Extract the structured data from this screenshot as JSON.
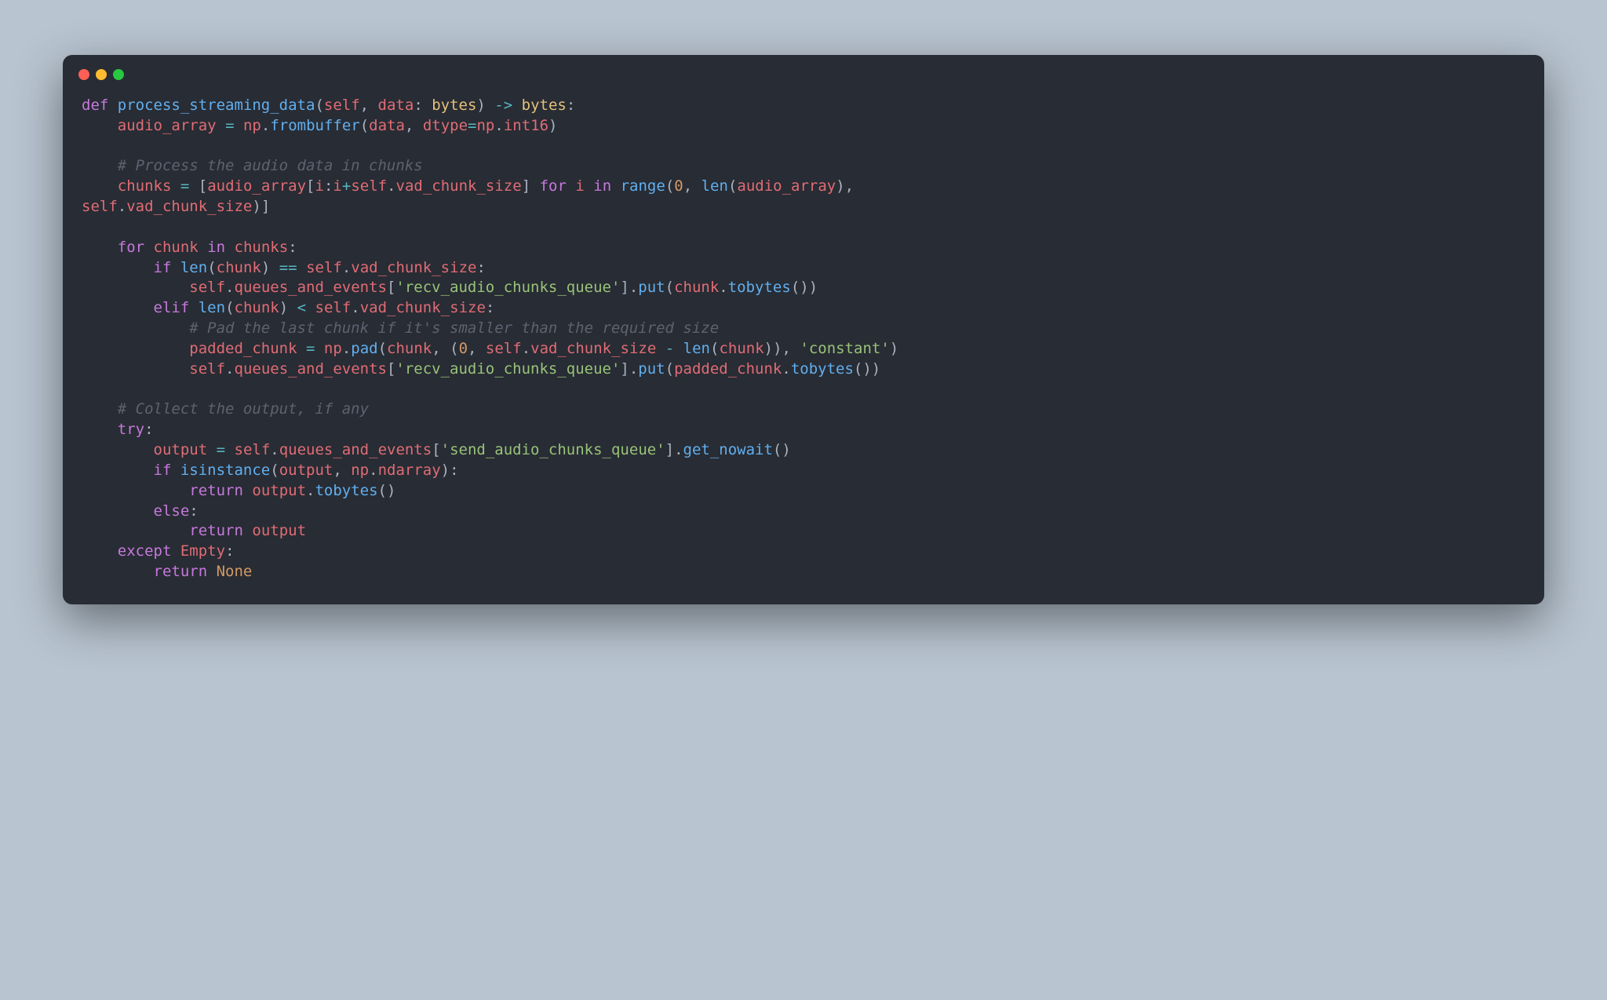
{
  "theme": {
    "page_bg": "#b8c4d0",
    "editor_bg": "#282c34",
    "foreground": "#abb2bf",
    "keyword": "#c678dd",
    "function": "#61afef",
    "type": "#e5c07b",
    "variable": "#e06c75",
    "operator": "#56b6c2",
    "string": "#98c379",
    "number": "#d19a66",
    "comment": "#5c6370",
    "constant": "#d19a66",
    "btn_red": "#ff5f57",
    "btn_yellow": "#febc2e",
    "btn_green": "#28c840"
  },
  "titlebar": {
    "btn1": "close",
    "btn2": "minimize",
    "btn3": "zoom"
  },
  "code": {
    "language": "python",
    "lines": [
      [
        [
          "kw",
          "def "
        ],
        [
          "fn",
          "process_streaming_data"
        ],
        [
          "pun",
          "("
        ],
        [
          "var",
          "self"
        ],
        [
          "pun",
          ", "
        ],
        [
          "var",
          "data"
        ],
        [
          "pun",
          ": "
        ],
        [
          "ty",
          "bytes"
        ],
        [
          "pun",
          ") "
        ],
        [
          "op",
          "->"
        ],
        [
          "pun",
          " "
        ],
        [
          "ty",
          "bytes"
        ],
        [
          "pun",
          ":"
        ]
      ],
      [
        [
          "pun",
          "    "
        ],
        [
          "var",
          "audio_array"
        ],
        [
          "pun",
          " "
        ],
        [
          "op",
          "="
        ],
        [
          "pun",
          " "
        ],
        [
          "var",
          "np"
        ],
        [
          "pun",
          "."
        ],
        [
          "fn",
          "frombuffer"
        ],
        [
          "pun",
          "("
        ],
        [
          "var",
          "data"
        ],
        [
          "pun",
          ", "
        ],
        [
          "var",
          "dtype"
        ],
        [
          "op",
          "="
        ],
        [
          "var",
          "np"
        ],
        [
          "pun",
          "."
        ],
        [
          "var",
          "int16"
        ],
        [
          "pun",
          ")"
        ]
      ],
      [
        [
          "pun",
          ""
        ]
      ],
      [
        [
          "pun",
          "    "
        ],
        [
          "com",
          "# Process the audio data in chunks"
        ]
      ],
      [
        [
          "pun",
          "    "
        ],
        [
          "var",
          "chunks"
        ],
        [
          "pun",
          " "
        ],
        [
          "op",
          "="
        ],
        [
          "pun",
          " ["
        ],
        [
          "var",
          "audio_array"
        ],
        [
          "pun",
          "["
        ],
        [
          "var",
          "i"
        ],
        [
          "pun",
          ":"
        ],
        [
          "var",
          "i"
        ],
        [
          "op",
          "+"
        ],
        [
          "var",
          "self"
        ],
        [
          "pun",
          "."
        ],
        [
          "var",
          "vad_chunk_size"
        ],
        [
          "pun",
          "] "
        ],
        [
          "kw",
          "for"
        ],
        [
          "pun",
          " "
        ],
        [
          "var",
          "i"
        ],
        [
          "pun",
          " "
        ],
        [
          "kw",
          "in"
        ],
        [
          "pun",
          " "
        ],
        [
          "fn",
          "range"
        ],
        [
          "pun",
          "("
        ],
        [
          "num",
          "0"
        ],
        [
          "pun",
          ", "
        ],
        [
          "fn",
          "len"
        ],
        [
          "pun",
          "("
        ],
        [
          "var",
          "audio_array"
        ],
        [
          "pun",
          "), "
        ]
      ],
      [
        [
          "var",
          "self"
        ],
        [
          "pun",
          "."
        ],
        [
          "var",
          "vad_chunk_size"
        ],
        [
          "pun",
          ")]"
        ]
      ],
      [
        [
          "pun",
          ""
        ]
      ],
      [
        [
          "pun",
          "    "
        ],
        [
          "kw",
          "for"
        ],
        [
          "pun",
          " "
        ],
        [
          "var",
          "chunk"
        ],
        [
          "pun",
          " "
        ],
        [
          "kw",
          "in"
        ],
        [
          "pun",
          " "
        ],
        [
          "var",
          "chunks"
        ],
        [
          "pun",
          ":"
        ]
      ],
      [
        [
          "pun",
          "        "
        ],
        [
          "kw",
          "if"
        ],
        [
          "pun",
          " "
        ],
        [
          "fn",
          "len"
        ],
        [
          "pun",
          "("
        ],
        [
          "var",
          "chunk"
        ],
        [
          "pun",
          ") "
        ],
        [
          "op",
          "=="
        ],
        [
          "pun",
          " "
        ],
        [
          "var",
          "self"
        ],
        [
          "pun",
          "."
        ],
        [
          "var",
          "vad_chunk_size"
        ],
        [
          "pun",
          ":"
        ]
      ],
      [
        [
          "pun",
          "            "
        ],
        [
          "var",
          "self"
        ],
        [
          "pun",
          "."
        ],
        [
          "var",
          "queues_and_events"
        ],
        [
          "pun",
          "["
        ],
        [
          "str",
          "'recv_audio_chunks_queue'"
        ],
        [
          "pun",
          "]."
        ],
        [
          "fn",
          "put"
        ],
        [
          "pun",
          "("
        ],
        [
          "var",
          "chunk"
        ],
        [
          "pun",
          "."
        ],
        [
          "fn",
          "tobytes"
        ],
        [
          "pun",
          "())"
        ]
      ],
      [
        [
          "pun",
          "        "
        ],
        [
          "kw",
          "elif"
        ],
        [
          "pun",
          " "
        ],
        [
          "fn",
          "len"
        ],
        [
          "pun",
          "("
        ],
        [
          "var",
          "chunk"
        ],
        [
          "pun",
          ") "
        ],
        [
          "op",
          "<"
        ],
        [
          "pun",
          " "
        ],
        [
          "var",
          "self"
        ],
        [
          "pun",
          "."
        ],
        [
          "var",
          "vad_chunk_size"
        ],
        [
          "pun",
          ":"
        ]
      ],
      [
        [
          "pun",
          "            "
        ],
        [
          "com",
          "# Pad the last chunk if it's smaller than the required size"
        ]
      ],
      [
        [
          "pun",
          "            "
        ],
        [
          "var",
          "padded_chunk"
        ],
        [
          "pun",
          " "
        ],
        [
          "op",
          "="
        ],
        [
          "pun",
          " "
        ],
        [
          "var",
          "np"
        ],
        [
          "pun",
          "."
        ],
        [
          "fn",
          "pad"
        ],
        [
          "pun",
          "("
        ],
        [
          "var",
          "chunk"
        ],
        [
          "pun",
          ", ("
        ],
        [
          "num",
          "0"
        ],
        [
          "pun",
          ", "
        ],
        [
          "var",
          "self"
        ],
        [
          "pun",
          "."
        ],
        [
          "var",
          "vad_chunk_size"
        ],
        [
          "pun",
          " "
        ],
        [
          "op",
          "-"
        ],
        [
          "pun",
          " "
        ],
        [
          "fn",
          "len"
        ],
        [
          "pun",
          "("
        ],
        [
          "var",
          "chunk"
        ],
        [
          "pun",
          ")), "
        ],
        [
          "str",
          "'constant'"
        ],
        [
          "pun",
          ")"
        ]
      ],
      [
        [
          "pun",
          "            "
        ],
        [
          "var",
          "self"
        ],
        [
          "pun",
          "."
        ],
        [
          "var",
          "queues_and_events"
        ],
        [
          "pun",
          "["
        ],
        [
          "str",
          "'recv_audio_chunks_queue'"
        ],
        [
          "pun",
          "]."
        ],
        [
          "fn",
          "put"
        ],
        [
          "pun",
          "("
        ],
        [
          "var",
          "padded_chunk"
        ],
        [
          "pun",
          "."
        ],
        [
          "fn",
          "tobytes"
        ],
        [
          "pun",
          "())"
        ]
      ],
      [
        [
          "pun",
          ""
        ]
      ],
      [
        [
          "pun",
          "    "
        ],
        [
          "com",
          "# Collect the output, if any"
        ]
      ],
      [
        [
          "pun",
          "    "
        ],
        [
          "kw",
          "try"
        ],
        [
          "pun",
          ":"
        ]
      ],
      [
        [
          "pun",
          "        "
        ],
        [
          "var",
          "output"
        ],
        [
          "pun",
          " "
        ],
        [
          "op",
          "="
        ],
        [
          "pun",
          " "
        ],
        [
          "var",
          "self"
        ],
        [
          "pun",
          "."
        ],
        [
          "var",
          "queues_and_events"
        ],
        [
          "pun",
          "["
        ],
        [
          "str",
          "'send_audio_chunks_queue'"
        ],
        [
          "pun",
          "]."
        ],
        [
          "fn",
          "get_nowait"
        ],
        [
          "pun",
          "()"
        ]
      ],
      [
        [
          "pun",
          "        "
        ],
        [
          "kw",
          "if"
        ],
        [
          "pun",
          " "
        ],
        [
          "fn",
          "isinstance"
        ],
        [
          "pun",
          "("
        ],
        [
          "var",
          "output"
        ],
        [
          "pun",
          ", "
        ],
        [
          "var",
          "np"
        ],
        [
          "pun",
          "."
        ],
        [
          "var",
          "ndarray"
        ],
        [
          "pun",
          "):"
        ]
      ],
      [
        [
          "pun",
          "            "
        ],
        [
          "kw",
          "return"
        ],
        [
          "pun",
          " "
        ],
        [
          "var",
          "output"
        ],
        [
          "pun",
          "."
        ],
        [
          "fn",
          "tobytes"
        ],
        [
          "pun",
          "()"
        ]
      ],
      [
        [
          "pun",
          "        "
        ],
        [
          "kw",
          "else"
        ],
        [
          "pun",
          ":"
        ]
      ],
      [
        [
          "pun",
          "            "
        ],
        [
          "kw",
          "return"
        ],
        [
          "pun",
          " "
        ],
        [
          "var",
          "output"
        ]
      ],
      [
        [
          "pun",
          "    "
        ],
        [
          "kw",
          "except"
        ],
        [
          "pun",
          " "
        ],
        [
          "var",
          "Empty"
        ],
        [
          "pun",
          ":"
        ]
      ],
      [
        [
          "pun",
          "        "
        ],
        [
          "kw",
          "return"
        ],
        [
          "pun",
          " "
        ],
        [
          "kwc",
          "None"
        ]
      ]
    ]
  }
}
